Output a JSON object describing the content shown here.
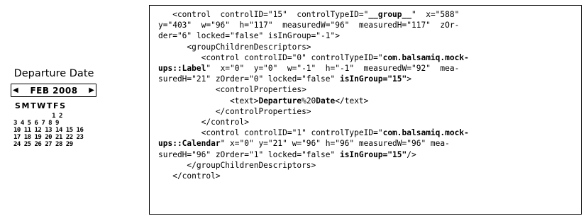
{
  "mockup": {
    "label": "Departure Date",
    "calendar": {
      "prev_arrow": "◀",
      "month": "FEB 2008",
      "next_arrow": "▶",
      "weekdays": "SMTWTFS",
      "rows": [
        "           1 2",
        "3 4 5 6 7 8 9",
        "10 11 12 13 14 15 16",
        "17 18 19 20 21 22 23",
        "24 25 26 27 28 29"
      ]
    }
  },
  "code": {
    "lines": [
      [
        {
          "t": "   <control  controlID=\"15\"  controlTypeID=\""
        },
        {
          "t": "__group__",
          "b": true
        },
        {
          "t": "\"  x=\"588\""
        }
      ],
      [
        {
          "t": "y=\"403\"  w=\"96\"  h=\"117\"  measuredW=\"96\"  measuredH=\"117\"  zOr-"
        }
      ],
      [
        {
          "t": "der=\"6\" locked=\"false\" isInGroup=\"-1\">"
        }
      ],
      [
        {
          "t": "      <groupChildrenDescriptors>"
        }
      ],
      [
        {
          "t": "         <control controlID=\"0\" controlTypeID=\""
        },
        {
          "t": "com.balsamiq.mock-",
          "b": true
        }
      ],
      [
        {
          "t": "ups::Label",
          "b": true
        },
        {
          "t": "\"  x=\"0\"  y=\"0\"  w=\"-1\"  h=\"-1\"  measuredW=\"92\"  mea-"
        }
      ],
      [
        {
          "t": "suredH=\"21\" zOrder=\"0\" locked=\"false\" "
        },
        {
          "t": "isInGroup=\"15\"",
          "b": true
        },
        {
          "t": ">"
        }
      ],
      [
        {
          "t": "            <controlProperties>"
        }
      ],
      [
        {
          "t": "               <text>"
        },
        {
          "t": "Departure",
          "b": true
        },
        {
          "t": "%20"
        },
        {
          "t": "Date",
          "b": true
        },
        {
          "t": "</text>"
        }
      ],
      [
        {
          "t": "            </controlProperties>"
        }
      ],
      [
        {
          "t": "         </control>"
        }
      ],
      [
        {
          "t": "         <control controlID=\"1\" controlTypeID=\""
        },
        {
          "t": "com.balsamiq.mock-",
          "b": true
        }
      ],
      [
        {
          "t": "ups::Calendar",
          "b": true
        },
        {
          "t": "\" x=\"0\" y=\"21\" w=\"96\" h=\"96\" measuredW=\"96\" mea-"
        }
      ],
      [
        {
          "t": "suredH=\"96\" zOrder=\"1\" locked=\"false\" "
        },
        {
          "t": "isInGroup=\"15\"",
          "b": true
        },
        {
          "t": "/>"
        }
      ],
      [
        {
          "t": "      </groupChildrenDescriptors>"
        }
      ],
      [
        {
          "t": "   </control>"
        }
      ]
    ]
  }
}
